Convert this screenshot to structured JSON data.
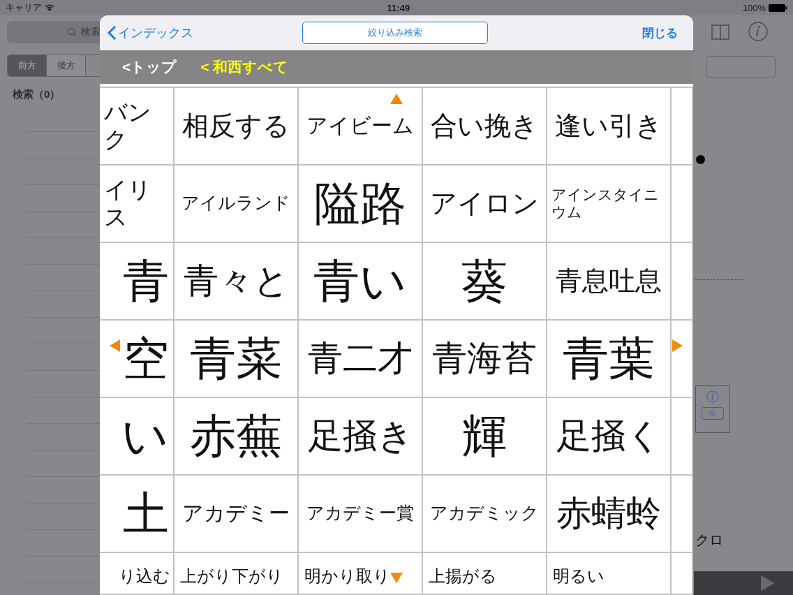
{
  "status_bar": {
    "carrier": "キャリア",
    "time": "11:49",
    "battery": "100%"
  },
  "background": {
    "search_placeholder": "検索",
    "segments": [
      {
        "label": "前方",
        "selected": true
      },
      {
        "label": "後方",
        "selected": false
      }
    ],
    "results_label": "検索（0）",
    "side_text": "クロ"
  },
  "modal": {
    "back": "インデックス",
    "filter_button": "絞り込み検索",
    "close": "閉じる",
    "breadcrumbs": [
      {
        "label": "<トップ",
        "selected": false
      },
      {
        "label": "< 和西すべて",
        "selected": true
      }
    ],
    "grid": {
      "rows": [
        {
          "cells": [
            "バンク",
            "相反する",
            "アイビーム",
            "合い挽き",
            "逢い引き"
          ]
        },
        {
          "cells": [
            "イリス",
            "アイルランド",
            "隘路",
            "アイロン",
            "アインスタイニウム"
          ]
        },
        {
          "cells": [
            "青",
            "青々と",
            "青い",
            "葵",
            "青息吐息"
          ]
        },
        {
          "cells": [
            "空",
            "青菜",
            "青二才",
            "青海苔",
            "青葉"
          ]
        },
        {
          "cells": [
            "い",
            "赤蕪",
            "足掻き",
            "輝",
            "足掻く"
          ]
        },
        {
          "cells": [
            "土",
            "アカデミー",
            "アカデミー賞",
            "アカデミック",
            "赤蜻蛉"
          ]
        },
        {
          "cells": [
            "り込む",
            "上がり下がり",
            "明かり取り",
            "上揚がる",
            "明るい"
          ]
        }
      ]
    }
  }
}
